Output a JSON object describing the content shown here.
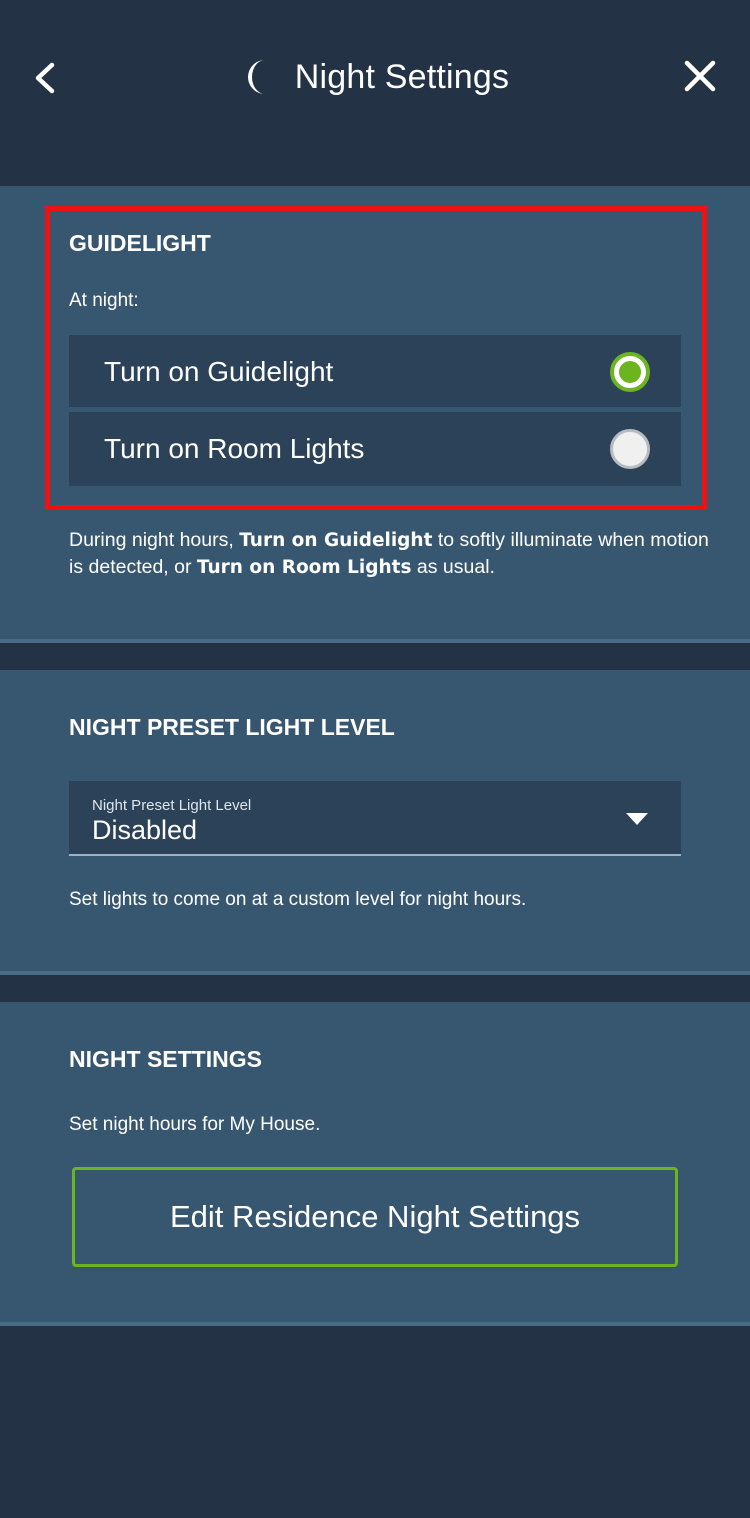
{
  "header": {
    "title": "Night Settings",
    "back_icon": "chevron-left-icon",
    "close_icon": "close-icon",
    "title_icon": "moon-icon"
  },
  "guidelight": {
    "section_title": "GUIDELIGHT",
    "subtitle": "At night:",
    "options": [
      {
        "label": "Turn on Guidelight",
        "selected": true
      },
      {
        "label": "Turn on Room Lights",
        "selected": false
      }
    ],
    "description": {
      "part1": "During night hours, ",
      "bold1": "Turn on Guidelight",
      "part2": " to softly illuminate when motion is detected, or ",
      "bold2": "Turn on Room Lights",
      "part3": " as usual."
    }
  },
  "preset": {
    "section_title": "NIGHT PRESET LIGHT LEVEL",
    "dropdown_label": "Night Preset Light Level",
    "dropdown_value": "Disabled",
    "description": "Set lights to come on at a custom level for night hours."
  },
  "night_settings": {
    "section_title": "NIGHT SETTINGS",
    "description": "Set night hours for My House.",
    "button_label": "Edit Residence Night Settings"
  },
  "colors": {
    "background_dark": "#233244",
    "section_bg": "#37566f",
    "row_bg": "#2b4258",
    "accent_green": "#6cb420",
    "highlight_red": "#ee1111"
  }
}
